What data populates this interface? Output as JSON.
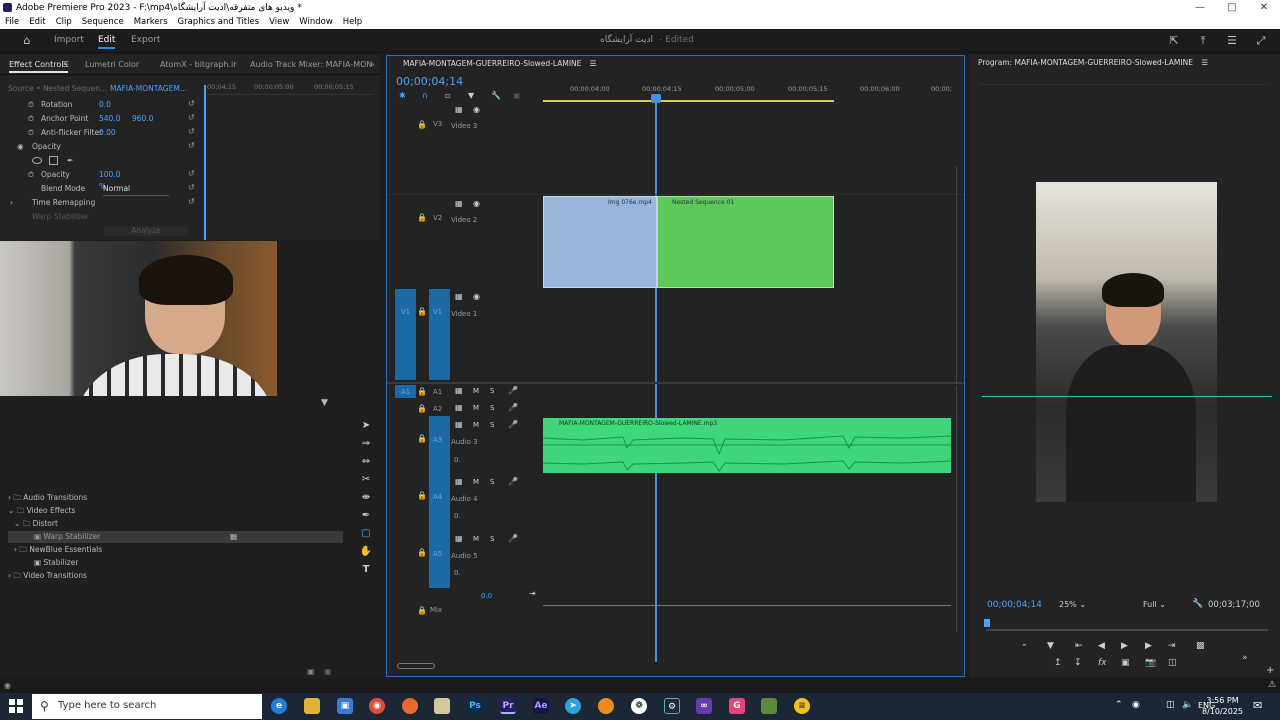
{
  "window": {
    "title": "Adobe Premiere Pro 2023 - F:\\mp4\\ویدیو های متفرقه\\ادیت آرایشگاه *",
    "min_icon": "minimize-icon",
    "max_icon": "maximize-icon",
    "close_icon": "close-icon"
  },
  "menu": [
    "File",
    "Edit",
    "Clip",
    "Sequence",
    "Markers",
    "Graphics and Titles",
    "View",
    "Window",
    "Help"
  ],
  "header": {
    "tabs": [
      "Import",
      "Edit",
      "Export"
    ],
    "active_tab": "Edit",
    "project_title": "ادیت آرایشگاه",
    "edited": "- Edited"
  },
  "left_panel": {
    "tabs": [
      "Effect Controls",
      "Lumetri Color",
      "AtomX - bitgraph.ir",
      "Audio Track Mixer: MAFIA-MON"
    ],
    "source_label": "Source • Nested Sequen...",
    "clip_label": "MAFIA-MONTAGEM...",
    "ruler": [
      "00;04;15",
      "00;00;05;00",
      "00;00;05;15"
    ],
    "rows": [
      {
        "name": "Rotation",
        "value": "0.0"
      },
      {
        "name": "Anchor Point",
        "value": "540.0",
        "value2": "960.0"
      },
      {
        "name": "Anti-flicker Filter",
        "value": "0.00"
      },
      {
        "name": "Opacity",
        "value": ""
      },
      {
        "name": "Opacity",
        "value": "100.0 %"
      },
      {
        "name": "Blend Mode",
        "value": "Normal"
      },
      {
        "name": "Time Remapping",
        "value": ""
      },
      {
        "name": "Warp Stabilizer",
        "value": ""
      }
    ],
    "analyze_btn": "Analyze"
  },
  "effects_panel": {
    "items": [
      {
        "label": "Audio Transitions",
        "indent": 0
      },
      {
        "label": "Video Effects",
        "indent": 0
      },
      {
        "label": "Distort",
        "indent": 1
      },
      {
        "label": "Warp Stabilizer",
        "indent": 2
      },
      {
        "label": "NewBlue Essentials",
        "indent": 1
      },
      {
        "label": "Stabilizer",
        "indent": 2
      },
      {
        "label": "Video Transitions",
        "indent": 0
      }
    ]
  },
  "timeline": {
    "sequence_tab": "MAFIA-MONTAGEM-GUERREIRO-Slowed-LAMINE",
    "timecode": "00;00;04;14",
    "ruler": [
      "00;00;04;00",
      "00;00;04;15",
      "00;00;05;00",
      "00;00;05;15",
      "00;00;06;00",
      "00;00;"
    ],
    "tracks": {
      "v3": "V3",
      "v3_name": "Video 3",
      "v2": "V2",
      "v2_name": "Video 2",
      "v1": "V1",
      "v1_name": "Video 1",
      "a1": "A1",
      "a2": "A2",
      "a3": "A3",
      "a3_name": "Audio 3",
      "a4": "A4",
      "a4_name": "Audio 4",
      "a5": "A5",
      "a5_name": "Audio 5",
      "mix": "Mix",
      "mix_val": "0.0"
    },
    "clips": {
      "img": "Img 076e.mp4",
      "nested": "Nested Sequence 01",
      "audio": "MAFIA-MONTAGEM-GUERREIRO-Slowed-LAMINE.mp3"
    }
  },
  "program": {
    "title": "Program: MAFIA-MONTAGEM-GUERREIRO-Slowed-LAMINE",
    "timecode": "00;00;04;14",
    "zoom": "25%",
    "quality": "Full",
    "duration": "00;03;17;00"
  },
  "taskbar": {
    "search_placeholder": "Type here to search",
    "time": "3:56 PM",
    "date": "8/10/2025",
    "lang": "ENG"
  },
  "colors": {
    "accent": "#2d8ceb",
    "clip_blue": "#9bb6dc",
    "clip_green": "#5ec85a",
    "audio": "#3dd67c",
    "track_blue": "#1b6aa5"
  }
}
